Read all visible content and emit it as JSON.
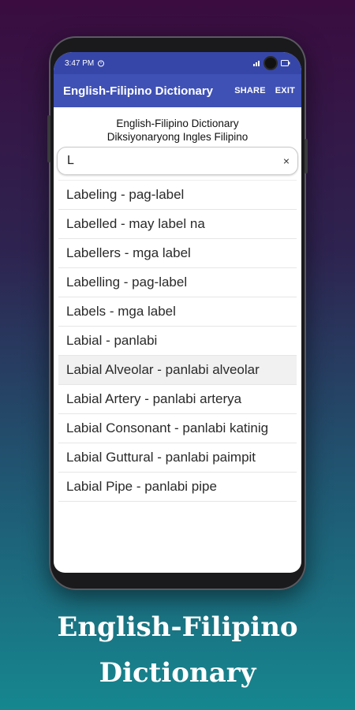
{
  "status_bar": {
    "time": "3:47 PM"
  },
  "app_bar": {
    "title": "English-Filipino Dictionary",
    "share_label": "SHARE",
    "exit_label": "EXIT"
  },
  "header": {
    "line1": "English-Filipino Dictionary",
    "line2": "Diksiyonaryong Ingles Filipino"
  },
  "search": {
    "value": "L",
    "clear_symbol": "×"
  },
  "results": [
    "Labeling - pag-label",
    "Labelled - may label na",
    "Labellers - mga label",
    "Labelling - pag-label",
    "Labels - mga label",
    "Labial - panlabi",
    "Labial Alveolar - panlabi alveolar",
    "Labial Artery - panlabi arterya",
    "Labial Consonant - panlabi katinig",
    "Labial Guttural - panlabi paimpit",
    "Labial Pipe - panlabi pipe"
  ],
  "caption": {
    "line1": "English-Filipino",
    "line2": "Dictionary"
  },
  "colors": {
    "app_bar": "#3f51b5",
    "status_bar": "#3646a8",
    "highlight_row": "#f1f1f1"
  }
}
